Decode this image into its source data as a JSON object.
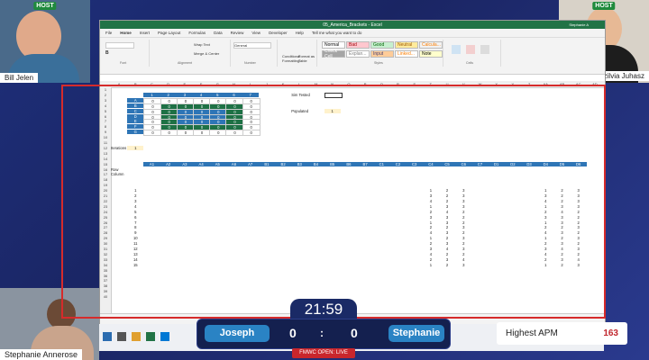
{
  "webcams": {
    "bill": {
      "name": "Bill Jelen",
      "badge": "HOST"
    },
    "szilvia": {
      "name": "Szilvia Juhasz",
      "badge": "HOST"
    },
    "stephanie": {
      "name": "Stephanie Annerose"
    }
  },
  "excel": {
    "title": "05_America_Brackets - Excel",
    "user": "Stephanie A",
    "menu": [
      "File",
      "Home",
      "Insert",
      "Page Layout",
      "Formulas",
      "Data",
      "Review",
      "View",
      "Developer",
      "Help",
      "Tell me what you want to do"
    ],
    "ribbon": {
      "wrap_text": "Wrap Text",
      "merge": "Merge & Center",
      "number_format": "General",
      "cond_format": "Conditional Formatting",
      "format_as_table": "Format as Table",
      "styles": [
        {
          "label": "Normal",
          "bg": "#ffffff",
          "fg": "#000000"
        },
        {
          "label": "Bad",
          "bg": "#ffc7ce",
          "fg": "#9c0006"
        },
        {
          "label": "Good",
          "bg": "#c6efce",
          "fg": "#006100"
        },
        {
          "label": "Neutral",
          "bg": "#ffeb9c",
          "fg": "#9c5700"
        },
        {
          "label": "Calcula...",
          "bg": "#f2f2f2",
          "fg": "#fa7d00"
        },
        {
          "label": "Check Cell",
          "bg": "#a5a5a5",
          "fg": "#ffffff"
        },
        {
          "label": "Explan...",
          "bg": "#ffffff",
          "fg": "#7f7f7f"
        },
        {
          "label": "Input",
          "bg": "#ffcc99",
          "fg": "#3f3f76"
        },
        {
          "label": "Linked...",
          "bg": "#ffffff",
          "fg": "#fa7d00"
        },
        {
          "label": "Note",
          "bg": "#ffffcc",
          "fg": "#000000"
        }
      ],
      "groups": [
        "Font",
        "Alignment",
        "Number",
        "Styles",
        "Cells"
      ]
    },
    "grid": {
      "col_letters": [
        "A",
        "B",
        "C",
        "D",
        "E",
        "F",
        "G",
        "H",
        "I",
        "J",
        "K",
        "L",
        "M",
        "N",
        "O",
        "P",
        "Q",
        "R",
        "S",
        "T",
        "U",
        "V",
        "W",
        "X",
        "Y",
        "Z",
        "AA",
        "AB",
        "AC",
        "AD"
      ],
      "matrix_header": [
        "1",
        "2",
        "3",
        "4",
        "5",
        "6",
        "7"
      ],
      "matrix_rows": [
        "A",
        "B",
        "C",
        "D",
        "E",
        "F",
        "G"
      ],
      "sim_tested_label": "Sim Tested",
      "populated_label": "Populated",
      "populated_value": "1",
      "iterations_label": "Iterations",
      "iterations_value": "1",
      "header_row": [
        "A1",
        "A2",
        "A3",
        "A4",
        "A5",
        "A6",
        "A7",
        "B1",
        "B2",
        "B3",
        "B4",
        "B5",
        "B6",
        "B7",
        "C1",
        "C2",
        "C3",
        "C4",
        "C5",
        "C6",
        "C7",
        "D1",
        "D2",
        "D3",
        "D4",
        "D5",
        "D6"
      ],
      "row_label": "Row",
      "column_label": "Column",
      "sample_rows": [
        [
          "1",
          "2",
          "3"
        ],
        [
          "3",
          "2",
          "3"
        ],
        [
          "4",
          "2",
          "3"
        ],
        [
          "1",
          "3",
          "3"
        ],
        [
          "2",
          "4",
          "2"
        ],
        [
          "3",
          "3",
          "2"
        ],
        [
          "1",
          "3",
          "2"
        ],
        [
          "2",
          "2",
          "3"
        ],
        [
          "4",
          "3",
          "2"
        ],
        [
          "1",
          "2",
          "3"
        ],
        [
          "2",
          "3",
          "2"
        ],
        [
          "3",
          "4",
          "3"
        ],
        [
          "4",
          "2",
          "2"
        ],
        [
          "2",
          "3",
          "4"
        ],
        [
          "1",
          "2",
          "3"
        ]
      ],
      "row_numbers": [
        "1",
        "2",
        "3",
        "4",
        "5",
        "6",
        "7",
        "8",
        "9",
        "10",
        "11",
        "12",
        "13",
        "14",
        "15"
      ]
    }
  },
  "match": {
    "timer": "21:59",
    "player_left": "Joseph",
    "score_left": "0",
    "separator": ":",
    "score_right": "0",
    "player_right": "Stephanie",
    "live_label": "FMWC OPEN: LIVE"
  },
  "apm": {
    "label": "Highest APM",
    "value": "163"
  }
}
